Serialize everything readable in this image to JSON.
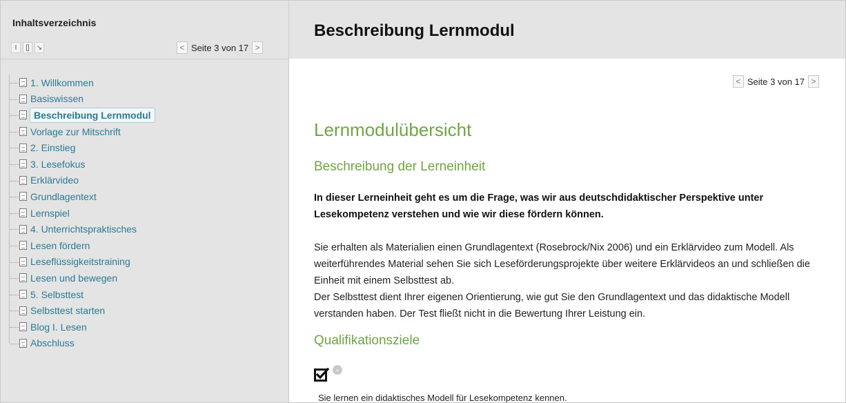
{
  "sidebar": {
    "title": "Inhaltsverzeichnis",
    "tools": [
      "I",
      "[]",
      "↘"
    ],
    "pager": {
      "prev": "<",
      "text": "Seite 3 von 17",
      "next": ">"
    },
    "items": [
      {
        "label": "1. Willkommen"
      },
      {
        "label": "Basiswissen"
      },
      {
        "label": "Beschreibung Lernmodul",
        "active": true
      },
      {
        "label": "Vorlage zur Mitschrift"
      },
      {
        "label": "2. Einstieg"
      },
      {
        "label": "3. Lesefokus"
      },
      {
        "label": "Erklärvideo"
      },
      {
        "label": "Grundlagentext"
      },
      {
        "label": "Lernspiel"
      },
      {
        "label": "4. Unterrichtspraktisches"
      },
      {
        "label": "Lesen fördern"
      },
      {
        "label": "Leseflüssigkeitstraining"
      },
      {
        "label": "Lesen und bewegen"
      },
      {
        "label": "5. Selbsttest"
      },
      {
        "label": "Selbsttest starten"
      },
      {
        "label": "Blog I. Lesen"
      },
      {
        "label": "Abschluss"
      }
    ]
  },
  "main": {
    "title": "Beschreibung Lernmodul",
    "pager": {
      "prev": "<",
      "text": "Seite 3 von 17",
      "next": ">"
    },
    "heading": "Lernmodulübersicht",
    "subheading1": "Beschreibung der Lerneinheit",
    "lead": "In dieser Lerneinheit geht es um die Frage, was wir aus deutschdidaktischer Perspektive unter Lesekompetenz verstehen und wie wir diese fördern können.",
    "paragraph1": "Sie erhalten als Materialien einen Grundlagentext (Rosebrock/Nix 2006) und ein Erklärvideo zum Modell. Als weiterführendes Material sehen Sie sich Leseförderungsprojekte über weitere Erklärvideos an und schließen die Einheit mit einem Selbsttest ab.",
    "paragraph2": "Der Selbsttest dient Ihrer eigenen Orientierung, wie gut Sie den Grundlagentext und das didaktische Modell verstanden haben. Der Test fließt nicht in die Bewertung Ihrer Leistung ein.",
    "subheading2": "Qualifikationsziele",
    "goal": "Sie lernen ein didaktisches Modell für Lesekompetenz kennen."
  },
  "colors": {
    "accent_green": "#6fa543",
    "link_blue": "#2a7a94",
    "panel_gray": "#e4e4e4"
  }
}
